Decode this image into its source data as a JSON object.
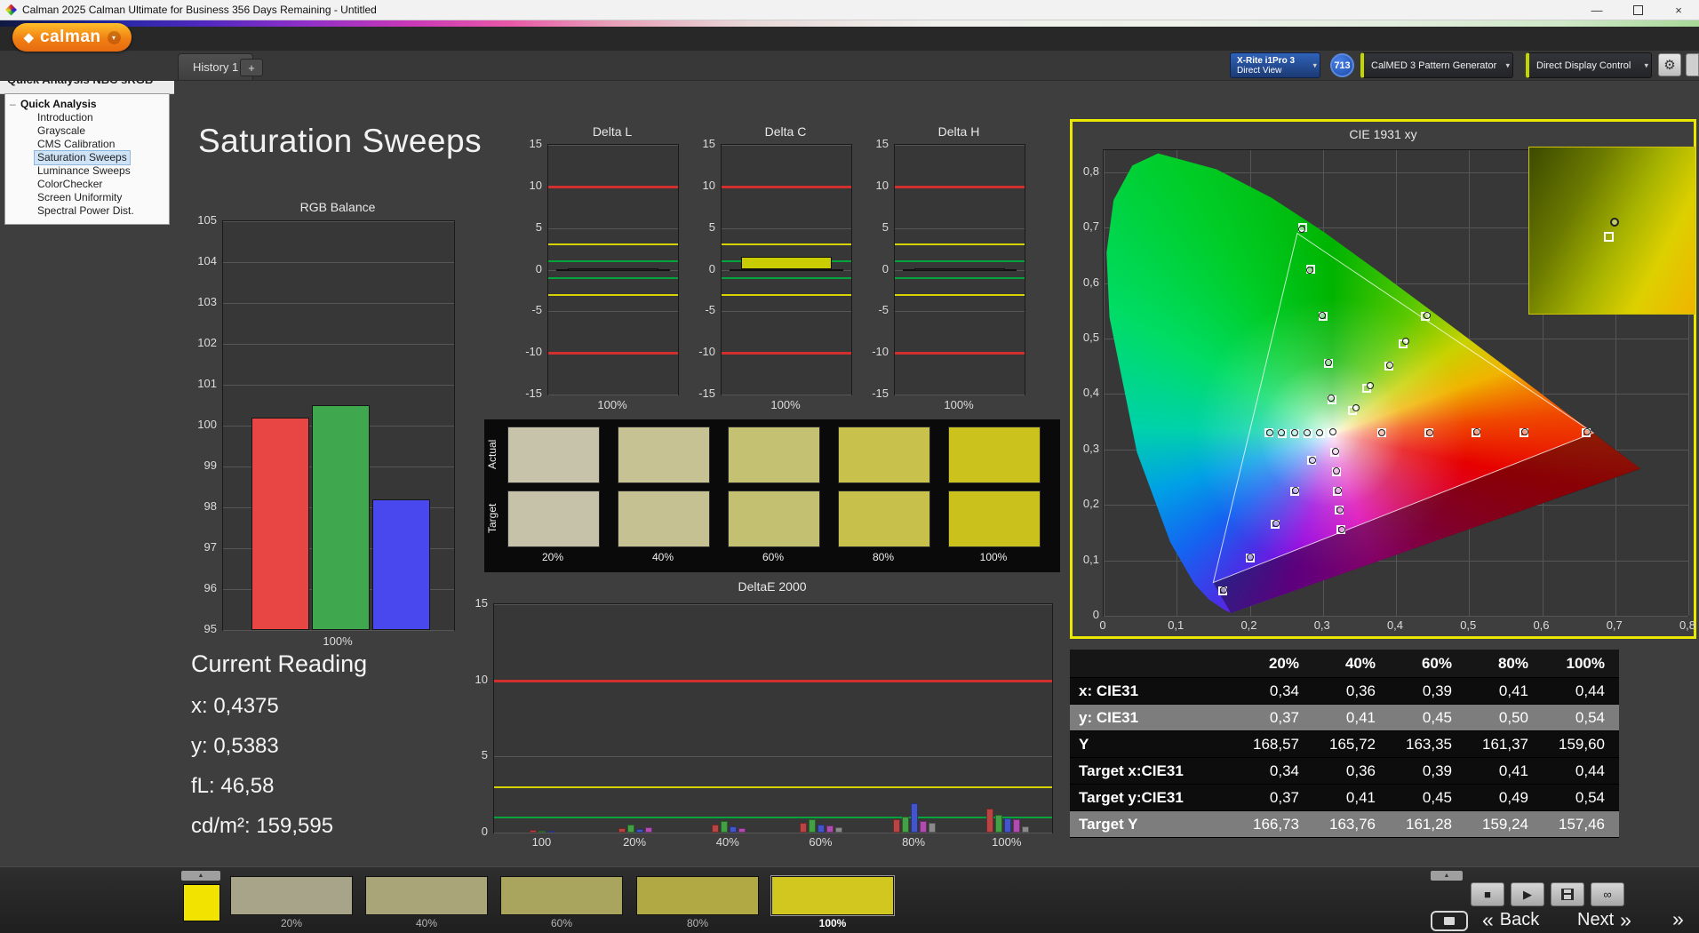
{
  "window": {
    "title": "Calman 2025 Calman Ultimate for Business 356 Days Remaining  - Untitled"
  },
  "icons": {
    "dropdown_chevron": "▾",
    "collapse_left": "◄",
    "gear": "⚙",
    "minimize": "—",
    "close": "×",
    "play": "▶",
    "stop": "■",
    "loop": "∞",
    "up_arrow": "▲",
    "back_chevrons": "«",
    "next_chevrons": "»",
    "logo_mark": "◆",
    "tree_collapse": "–"
  },
  "brand": {
    "logo_text": "calman"
  },
  "tab_bar": {
    "history_tab": "History 1",
    "add_tab": "+"
  },
  "device_bar": {
    "meter": {
      "line1": "X-Rite i1Pro 3",
      "line2": "Direct View"
    },
    "badge": "713",
    "pattern_generator": "CalMED 3 Pattern Generator",
    "display_control": "Direct Display Control"
  },
  "sidebar": {
    "title": "Quick Analysis NBC sRGB",
    "root": "Quick Analysis",
    "selected_index": 3,
    "items": [
      "Introduction",
      "Grayscale",
      "CMS Calibration",
      "Saturation Sweeps",
      "Luminance Sweeps",
      "ColorChecker",
      "Screen Uniformity",
      "Spectral Power Dist."
    ]
  },
  "page_title": "Saturation Sweeps",
  "rgb_balance": {
    "title": "RGB Balance",
    "ymin": 95,
    "ymax": 105,
    "ystep": 1,
    "xlabel": "100%",
    "bars": [
      {
        "name": "red",
        "value": 100.2,
        "color": "#e84545"
      },
      {
        "name": "green",
        "value": 100.5,
        "color": "#3fa84f"
      },
      {
        "name": "blue",
        "value": 98.2,
        "color": "#4848ee"
      }
    ]
  },
  "delta_charts": {
    "ymin": -15,
    "ymax": 15,
    "ystep": 5,
    "xlabel": "100%",
    "limits": {
      "red": 10,
      "yellow": 3,
      "green": 1
    },
    "charts": [
      {
        "title": "Delta L",
        "value": 0.15,
        "bar_color": "#202020"
      },
      {
        "title": "Delta C",
        "value": 1.6,
        "bar_color": "#c8cc00"
      },
      {
        "title": "Delta H",
        "value": 0.15,
        "bar_color": "#202020"
      }
    ]
  },
  "saturation_swatches": {
    "row_labels": [
      "Actual",
      "Target"
    ],
    "column_labels": [
      "20%",
      "40%",
      "60%",
      "80%",
      "100%"
    ],
    "actual_colors": [
      "#c7c3ab",
      "#c7c293",
      "#c5c172",
      "#c8c24d",
      "#cbc21d"
    ],
    "target_colors": [
      "#c6c2aa",
      "#c6c192",
      "#c4c071",
      "#c7c14c",
      "#cac11c"
    ]
  },
  "deltae_chart": {
    "title": "DeltaE 2000",
    "ymin": 0,
    "ymax": 15,
    "ystep": 5,
    "limits": {
      "red": 10,
      "yellow": 3,
      "green": 1
    },
    "tick_labels": [
      "100",
      "20%",
      "40%",
      "60%",
      "80%",
      "100%"
    ],
    "bar_colors": [
      "#b84444",
      "#44a044",
      "#4455cc",
      "#b04cb0",
      "#8a8a8a"
    ],
    "groups": [
      [
        0.2,
        0.12,
        0.08
      ],
      [
        0.3,
        0.55,
        0.22,
        0.38
      ],
      [
        0.5,
        0.75,
        0.42,
        0.3
      ],
      [
        0.65,
        0.85,
        0.55,
        0.45,
        0.35
      ],
      [
        0.85,
        1.05,
        1.9,
        0.75,
        0.65
      ],
      [
        1.55,
        1.15,
        0.95,
        0.85,
        0.4
      ]
    ]
  },
  "cie_chart": {
    "title": "CIE 1931 xy",
    "x_ticks": [
      "0",
      "0,1",
      "0,2",
      "0,3",
      "0,4",
      "0,5",
      "0,6",
      "0,7",
      "0,8"
    ],
    "y_ticks": [
      "0",
      "0,1",
      "0,2",
      "0,3",
      "0,4",
      "0,5",
      "0,6",
      "0,7",
      "0,8"
    ],
    "targets": [
      [
        0.38,
        0.33
      ],
      [
        0.445,
        0.33
      ],
      [
        0.51,
        0.331
      ],
      [
        0.575,
        0.331
      ],
      [
        0.66,
        0.331
      ],
      [
        0.312,
        0.39
      ],
      [
        0.308,
        0.455
      ],
      [
        0.3,
        0.54
      ],
      [
        0.283,
        0.625
      ],
      [
        0.272,
        0.7
      ],
      [
        0.285,
        0.28
      ],
      [
        0.262,
        0.225
      ],
      [
        0.235,
        0.165
      ],
      [
        0.2,
        0.105
      ],
      [
        0.163,
        0.045
      ],
      [
        0.34,
        0.37
      ],
      [
        0.36,
        0.41
      ],
      [
        0.39,
        0.45
      ],
      [
        0.41,
        0.49
      ],
      [
        0.44,
        0.54
      ],
      [
        0.297,
        0.329
      ],
      [
        0.28,
        0.329
      ],
      [
        0.262,
        0.329
      ],
      [
        0.244,
        0.329
      ],
      [
        0.226,
        0.33
      ],
      [
        0.316,
        0.295
      ],
      [
        0.318,
        0.26
      ],
      [
        0.32,
        0.225
      ],
      [
        0.322,
        0.19
      ],
      [
        0.325,
        0.155
      ],
      [
        0.313,
        0.331
      ]
    ],
    "measurements": [
      [
        0.345,
        0.375
      ],
      [
        0.365,
        0.415
      ],
      [
        0.392,
        0.452
      ],
      [
        0.413,
        0.495
      ],
      [
        0.442,
        0.542
      ],
      [
        0.311,
        0.392
      ],
      [
        0.307,
        0.457
      ],
      [
        0.299,
        0.542
      ],
      [
        0.282,
        0.623
      ],
      [
        0.271,
        0.698
      ],
      [
        0.296,
        0.33
      ],
      [
        0.279,
        0.33
      ],
      [
        0.261,
        0.33
      ],
      [
        0.243,
        0.33
      ],
      [
        0.227,
        0.331
      ],
      [
        0.381,
        0.331
      ],
      [
        0.446,
        0.331
      ],
      [
        0.511,
        0.332
      ],
      [
        0.576,
        0.332
      ],
      [
        0.661,
        0.332
      ],
      [
        0.286,
        0.281
      ],
      [
        0.263,
        0.226
      ],
      [
        0.236,
        0.166
      ],
      [
        0.201,
        0.106
      ],
      [
        0.164,
        0.046
      ],
      [
        0.317,
        0.296
      ],
      [
        0.319,
        0.261
      ],
      [
        0.321,
        0.226
      ],
      [
        0.323,
        0.191
      ],
      [
        0.326,
        0.156
      ],
      [
        0.314,
        0.332
      ]
    ]
  },
  "results_table": {
    "columns": [
      "20%",
      "40%",
      "60%",
      "80%",
      "100%"
    ],
    "rows": [
      {
        "label": "x: CIE31",
        "values": [
          "0,34",
          "0,36",
          "0,39",
          "0,41",
          "0,44"
        ],
        "shade": false
      },
      {
        "label": "y: CIE31",
        "values": [
          "0,37",
          "0,41",
          "0,45",
          "0,50",
          "0,54"
        ],
        "shade": true
      },
      {
        "label": "Y",
        "values": [
          "168,57",
          "165,72",
          "163,35",
          "161,37",
          "159,60"
        ],
        "shade": false
      },
      {
        "label": "Target x:CIE31",
        "values": [
          "0,34",
          "0,36",
          "0,39",
          "0,41",
          "0,44"
        ],
        "shade": false
      },
      {
        "label": "Target y:CIE31",
        "values": [
          "0,37",
          "0,41",
          "0,45",
          "0,49",
          "0,54"
        ],
        "shade": false
      },
      {
        "label": "Target Y",
        "values": [
          "166,73",
          "163,76",
          "161,28",
          "159,24",
          "157,46"
        ],
        "shade": true
      }
    ]
  },
  "current_reading": {
    "title": "Current Reading",
    "lines": [
      "x: 0,4375",
      "y: 0,5383",
      "fL: 46,58",
      "cd/m²: 159,595"
    ]
  },
  "bottom_bar": {
    "active_patch_color": "#f2e400",
    "thumbs": [
      {
        "label": "20%",
        "color": "#a8a489",
        "active": false
      },
      {
        "label": "40%",
        "color": "#aaa578",
        "active": false
      },
      {
        "label": "60%",
        "color": "#aaa55e",
        "active": false
      },
      {
        "label": "80%",
        "color": "#b1a943",
        "active": false
      },
      {
        "label": "100%",
        "color": "#d2c71e",
        "active": true
      }
    ],
    "back_label": "Back",
    "next_label": "Next"
  }
}
